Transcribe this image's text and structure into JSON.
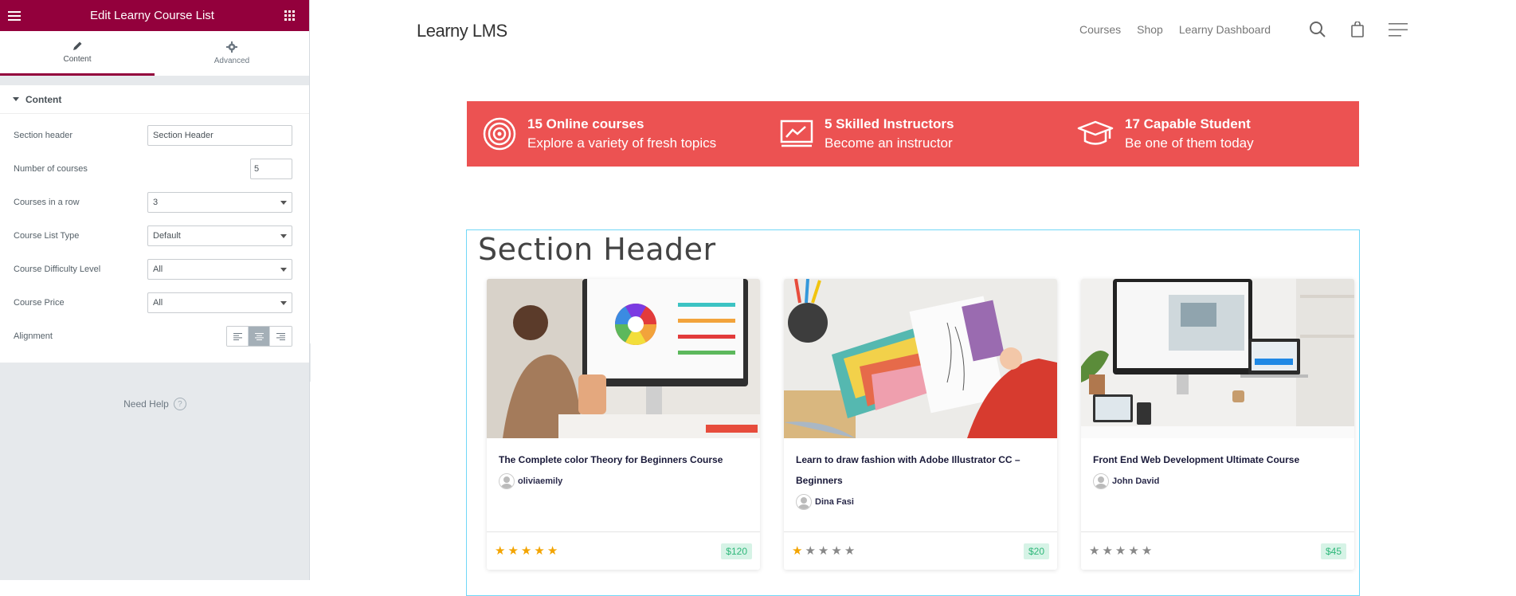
{
  "panel": {
    "title": "Edit Learny Course List",
    "tabs": [
      {
        "label": "Content"
      },
      {
        "label": "Advanced"
      }
    ],
    "section_title": "Content",
    "controls": {
      "section_header": {
        "label": "Section header",
        "value": "Section Header"
      },
      "number_of_courses": {
        "label": "Number of courses",
        "value": "5"
      },
      "courses_in_row": {
        "label": "Courses in a row",
        "value": "3"
      },
      "course_list_type": {
        "label": "Course List Type",
        "value": "Default"
      },
      "difficulty": {
        "label": "Course Difficulty Level",
        "value": "All"
      },
      "price": {
        "label": "Course Price",
        "value": "All"
      },
      "alignment": {
        "label": "Alignment",
        "selected": "center"
      }
    },
    "help": "Need Help"
  },
  "site": {
    "logo": "Learny LMS",
    "nav": [
      "Courses",
      "Shop",
      "Learny Dashboard"
    ]
  },
  "stats": [
    {
      "title": "15 Online courses",
      "subtitle": "Explore a variety of fresh topics",
      "icon": "target-icon"
    },
    {
      "title": "5 Skilled Instructors",
      "subtitle": "Become an instructor",
      "icon": "presentation-icon"
    },
    {
      "title": "17 Capable Student",
      "subtitle": "Be one of them today",
      "icon": "graduation-cap-icon"
    }
  ],
  "section": {
    "header": "Section Header",
    "courses": [
      {
        "title": "The Complete color Theory for Beginners Course",
        "author": "oliviaemily",
        "rating": 5,
        "price": "$120"
      },
      {
        "title": "Learn to draw fashion with Adobe Illustrator CC – Beginners",
        "author": "Dina Fasi",
        "rating": 1,
        "price": "$20"
      },
      {
        "title": "Front End Web Development Ultimate Course",
        "author": "John David",
        "rating": 0,
        "price": "$45"
      }
    ]
  },
  "colors": {
    "brand": "#93003c",
    "stats_bg": "#ec5252",
    "star": "#f3a400",
    "price_bg": "#d6f3e6",
    "price_text": "#2eb77a"
  }
}
